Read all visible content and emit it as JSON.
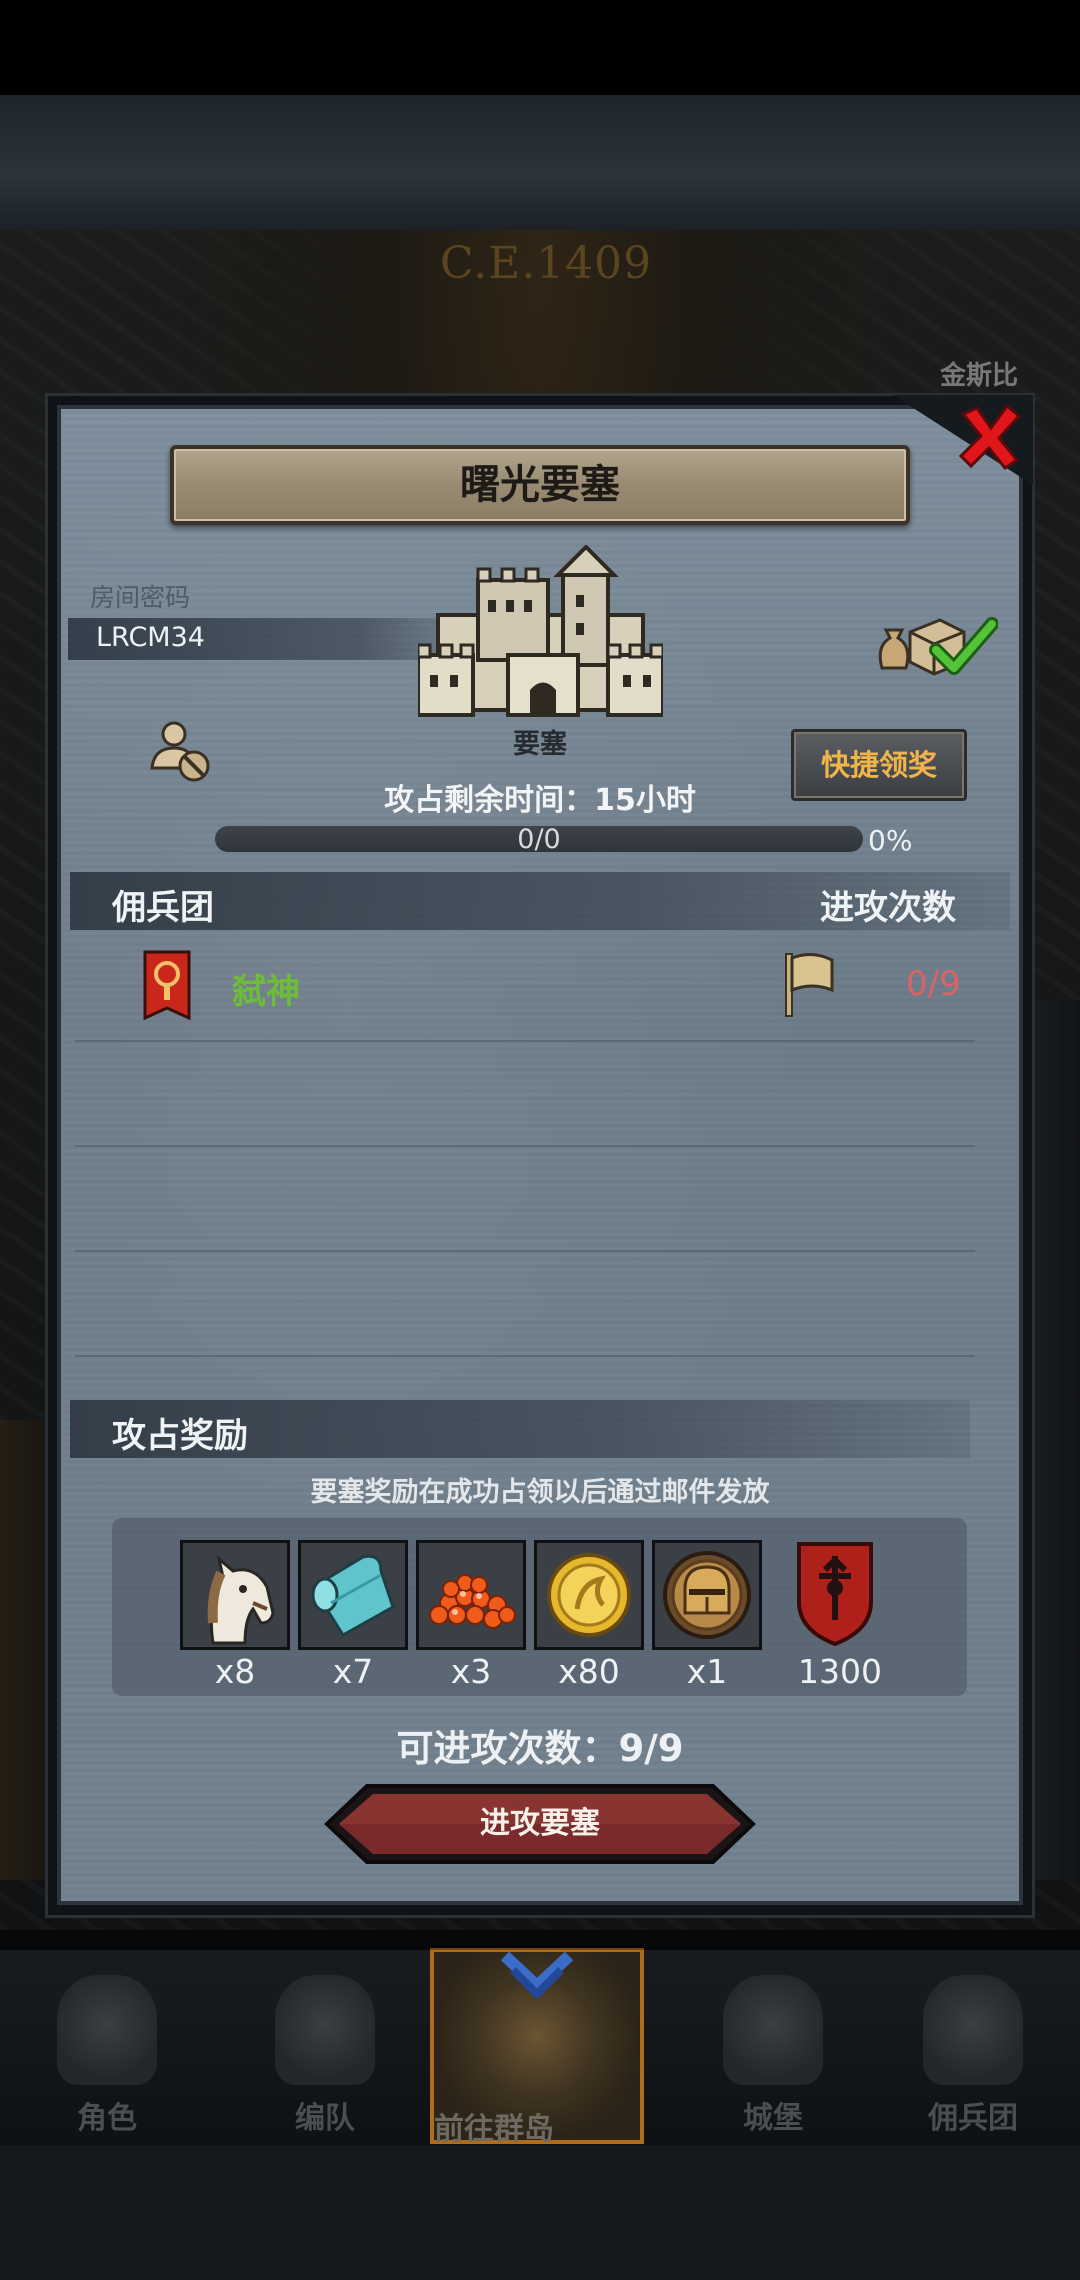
{
  "background": {
    "era": "C.E.1409",
    "city_label": "金斯比"
  },
  "dialog": {
    "title": "曙光要塞",
    "room_password_label": "房间密码",
    "room_password_value": "LRCM34",
    "castle_label": "要塞",
    "quick_claim_button": "快捷领奖",
    "time_remaining": "攻占剩余时间：15小时",
    "progress": {
      "text": "0/0",
      "percent_text": "0%",
      "fraction": 0
    },
    "mercenary_header": "佣兵团",
    "attack_count_header": "进攻次数",
    "rows": [
      {
        "name": "弑神",
        "count": "0/9"
      }
    ],
    "reward_header": "攻占奖励",
    "reward_note": "要塞奖励在成功占领以后通过邮件发放",
    "rewards": [
      {
        "icon": "horse-icon",
        "count": "x8"
      },
      {
        "icon": "cloth-roll-icon",
        "count": "x7"
      },
      {
        "icon": "orange-gems-icon",
        "count": "x3"
      },
      {
        "icon": "gold-coin-icon",
        "count": "x80"
      },
      {
        "icon": "knight-helmet-medal-icon",
        "count": "x1"
      },
      {
        "icon": "guild-shield-icon",
        "count": "1300"
      }
    ],
    "attempts_text": "可进攻次数：9/9",
    "attack_button": "进攻要塞"
  },
  "bottom_nav": [
    {
      "label": "角色",
      "icon": "character-icon"
    },
    {
      "label": "编队",
      "icon": "formation-icon"
    },
    {
      "label": "前往群岛",
      "icon": "islands-icon",
      "active": true
    },
    {
      "label": "城堡",
      "icon": "castle-icon"
    },
    {
      "label": "佣兵团",
      "icon": "mercenary-icon"
    }
  ],
  "colors": {
    "accent_orange": "#f0b44b",
    "mercenary_name_green": "#6ebd39",
    "attack_count_red": "#d86467",
    "close_red": "#e0161b",
    "attack_button_red": "#7a2a2a"
  }
}
